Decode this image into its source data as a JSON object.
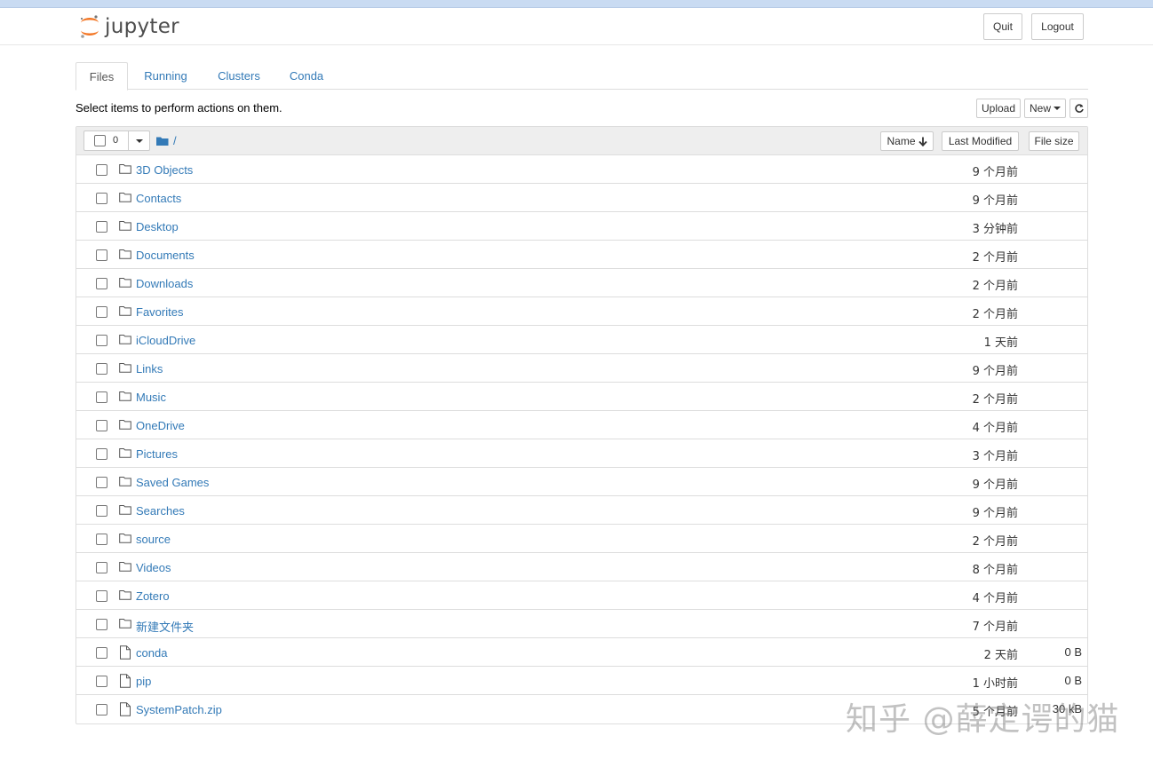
{
  "app": {
    "logo_text": "jupyter",
    "quit_label": "Quit",
    "logout_label": "Logout"
  },
  "tabs": [
    {
      "label": "Files",
      "active": true
    },
    {
      "label": "Running",
      "active": false
    },
    {
      "label": "Clusters",
      "active": false
    },
    {
      "label": "Conda",
      "active": false
    }
  ],
  "toolbar": {
    "hint": "Select items to perform actions on them.",
    "upload_label": "Upload",
    "new_label": "New",
    "refresh_icon": "refresh-icon"
  },
  "list_header": {
    "selected_count": "0",
    "breadcrumb": "/",
    "sort_name_label": "Name",
    "sort_modified_label": "Last Modified",
    "sort_size_label": "File size"
  },
  "items": [
    {
      "name": "3D Objects",
      "type": "folder",
      "modified": "9 个月前",
      "size": ""
    },
    {
      "name": "Contacts",
      "type": "folder",
      "modified": "9 个月前",
      "size": ""
    },
    {
      "name": "Desktop",
      "type": "folder",
      "modified": "3 分钟前",
      "size": ""
    },
    {
      "name": "Documents",
      "type": "folder",
      "modified": "2 个月前",
      "size": ""
    },
    {
      "name": "Downloads",
      "type": "folder",
      "modified": "2 个月前",
      "size": ""
    },
    {
      "name": "Favorites",
      "type": "folder",
      "modified": "2 个月前",
      "size": ""
    },
    {
      "name": "iCloudDrive",
      "type": "folder",
      "modified": "1 天前",
      "size": ""
    },
    {
      "name": "Links",
      "type": "folder",
      "modified": "9 个月前",
      "size": ""
    },
    {
      "name": "Music",
      "type": "folder",
      "modified": "2 个月前",
      "size": ""
    },
    {
      "name": "OneDrive",
      "type": "folder",
      "modified": "4 个月前",
      "size": ""
    },
    {
      "name": "Pictures",
      "type": "folder",
      "modified": "3 个月前",
      "size": ""
    },
    {
      "name": "Saved Games",
      "type": "folder",
      "modified": "9 个月前",
      "size": ""
    },
    {
      "name": "Searches",
      "type": "folder",
      "modified": "9 个月前",
      "size": ""
    },
    {
      "name": "source",
      "type": "folder",
      "modified": "2 个月前",
      "size": ""
    },
    {
      "name": "Videos",
      "type": "folder",
      "modified": "8 个月前",
      "size": ""
    },
    {
      "name": "Zotero",
      "type": "folder",
      "modified": "4 个月前",
      "size": ""
    },
    {
      "name": "新建文件夹",
      "type": "folder",
      "modified": "7 个月前",
      "size": ""
    },
    {
      "name": "conda",
      "type": "file",
      "modified": "2 天前",
      "size": "0 B"
    },
    {
      "name": "pip",
      "type": "file",
      "modified": "1 小时前",
      "size": "0 B"
    },
    {
      "name": "SystemPatch.zip",
      "type": "file",
      "modified": "5 个月前",
      "size": "30 kB"
    }
  ],
  "watermark": "知乎 @薛定谔的猫",
  "colors": {
    "link": "#337ab7",
    "logo_orange": "#f37726",
    "top_strip": "#c9dbf2"
  }
}
